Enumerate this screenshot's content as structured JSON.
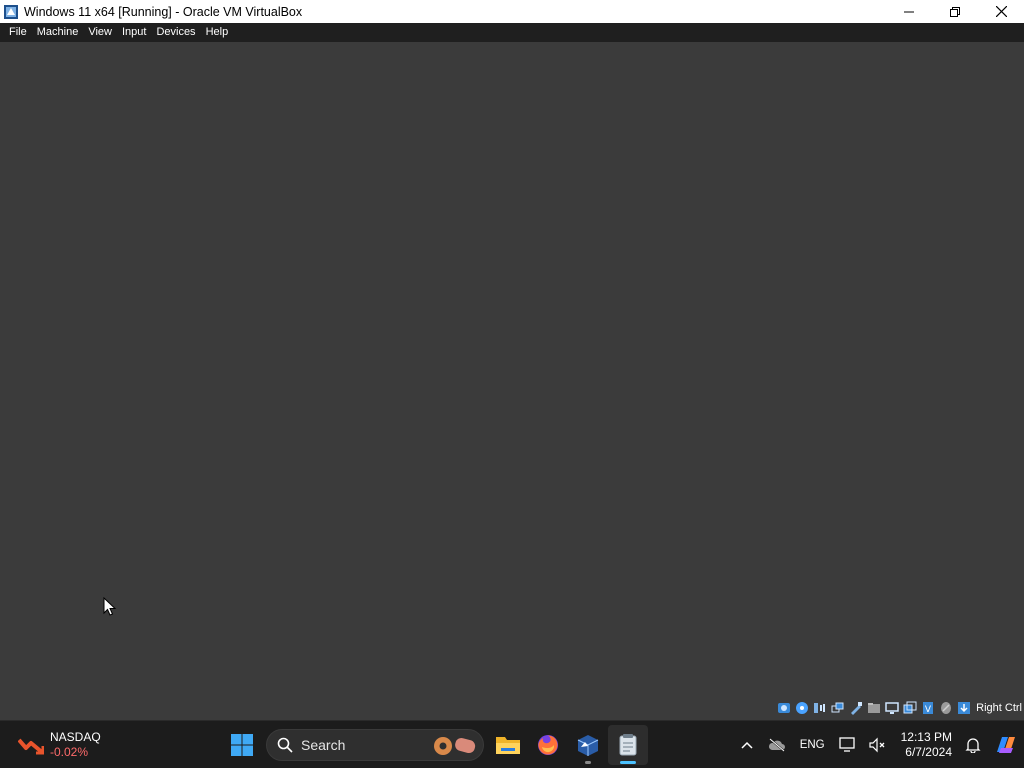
{
  "window": {
    "title": "Windows 11 x64 [Running] - Oracle VM VirtualBox",
    "controls": [
      "minimize",
      "maximize",
      "close"
    ]
  },
  "menubar": {
    "items": [
      "File",
      "Machine",
      "View",
      "Input",
      "Devices",
      "Help"
    ]
  },
  "vm_statusbar": {
    "icons": [
      "hard-disk-icon",
      "optical-drive-icon",
      "audio-icon",
      "network-icon",
      "usb-icon",
      "shared-folders-icon",
      "display-icon",
      "recording-icon",
      "virtualization-icon",
      "mouse-integration-icon",
      "keyboard-icon"
    ],
    "host_key": "Right Ctrl"
  },
  "taskbar": {
    "widget": {
      "name": "NASDAQ",
      "change": "-0.02%",
      "change_color": "#ff6b6b"
    },
    "search_label": "Search",
    "apps": [
      "start-icon",
      "file-explorer-icon",
      "firefox-icon",
      "virtualbox-icon",
      "notepad-icon"
    ],
    "tray": {
      "language": "ENG",
      "time": "12:13 PM",
      "date": "6/7/2024"
    }
  },
  "colors": {
    "vm_background": "#3b3b3b",
    "taskbar": "#1c1c1c",
    "accent": "#4cc2ff"
  }
}
